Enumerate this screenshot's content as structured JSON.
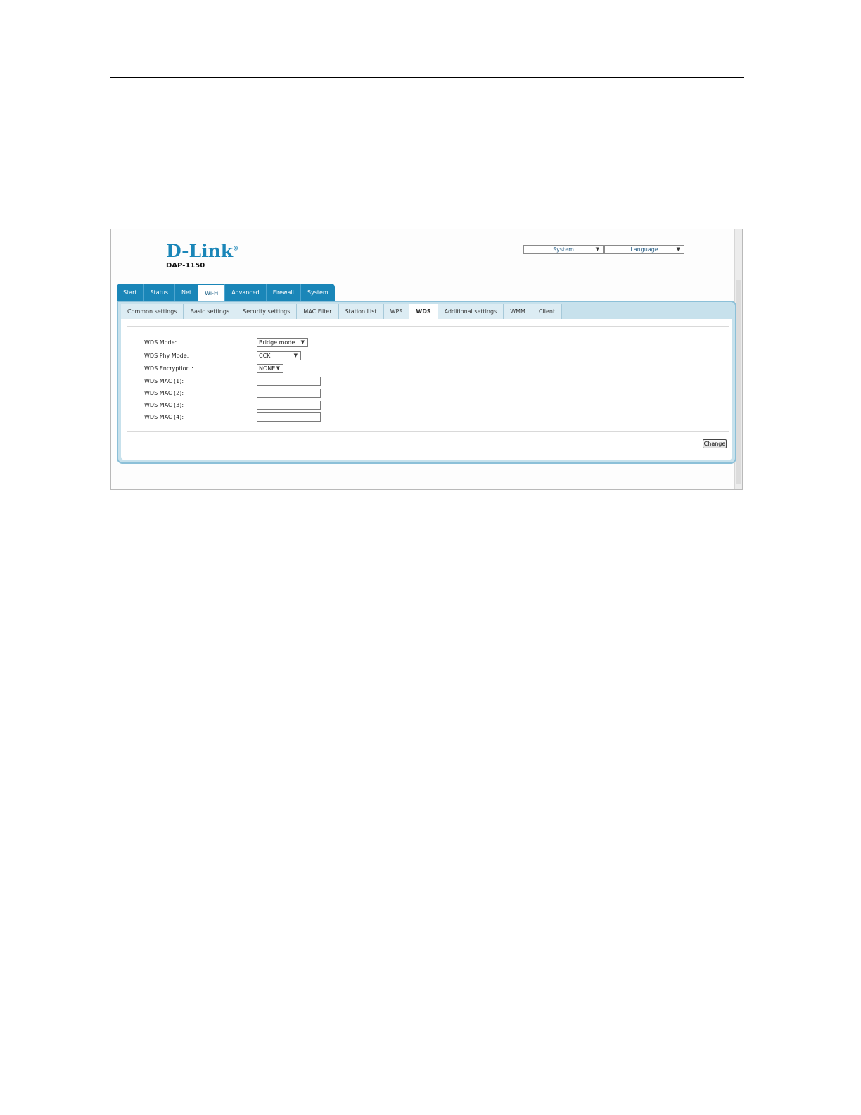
{
  "brand": {
    "name": "D-Link",
    "model": "DAP-1150"
  },
  "top_selects": {
    "system": "System",
    "language": "Language"
  },
  "main_tabs": [
    "Start",
    "Status",
    "Net",
    "Wi-Fi",
    "Advanced",
    "Firewall",
    "System"
  ],
  "main_tab_active": "Wi-Fi",
  "sub_tabs": [
    "Common settings",
    "Basic settings",
    "Security settings",
    "MAC Filter",
    "Station List",
    "WPS",
    "WDS",
    "Additional settings",
    "WMM",
    "Client"
  ],
  "sub_tab_active": "WDS",
  "form": {
    "wds_mode": {
      "label": "WDS Mode:",
      "value": "Bridge mode"
    },
    "wds_phy_mode": {
      "label": "WDS Phy Mode:",
      "value": "CCK"
    },
    "wds_encryption": {
      "label": "WDS Encryption :",
      "value": "NONE"
    },
    "wds_mac_1": {
      "label": "WDS MAC (1):",
      "value": ""
    },
    "wds_mac_2": {
      "label": "WDS MAC (2):",
      "value": ""
    },
    "wds_mac_3": {
      "label": "WDS MAC (3):",
      "value": ""
    },
    "wds_mac_4": {
      "label": "WDS MAC (4):",
      "value": ""
    }
  },
  "buttons": {
    "change": "Change"
  },
  "colors": {
    "accent": "#1a86b8",
    "panel_bg": "#c7e1ec"
  }
}
